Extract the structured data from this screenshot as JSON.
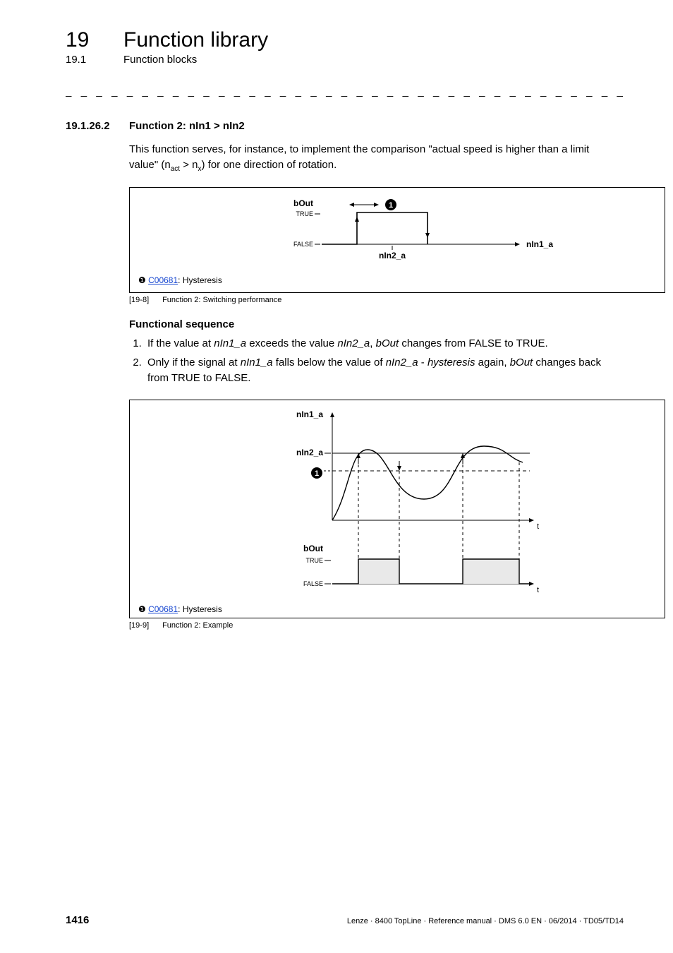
{
  "chapter": {
    "num": "19",
    "title": "Function library"
  },
  "section": {
    "num": "19.1",
    "title": "Function blocks"
  },
  "dash_rule": "_ _ _ _ _ _ _ _ _ _ _ _ _ _ _ _ _ _ _ _ _ _ _ _ _ _ _ _ _ _ _ _ _ _ _ _ _ _ _ _ _ _ _ _ _ _ _ _ _ _ _ _ _ _ _ _ _ _ _ _ _ _ _ _",
  "subsection": {
    "num": "19.1.26.2",
    "title": "Function 2: nIn1 > nIn2"
  },
  "intro": {
    "line1": "This function serves, for instance, to implement the comparison \"actual speed  is higher than a limit",
    "line2_pre": "value\" (n",
    "line2_sub1": "act",
    "line2_mid": " > n",
    "line2_sub2": "x",
    "line2_post": ") for one direction of rotation."
  },
  "fig8": {
    "labels": {
      "bOut": "bOut",
      "true": "TRUE",
      "false": "FALSE",
      "nIn2": "nIn2_a",
      "nIn1": "nIn1_a",
      "circ": "1"
    },
    "legend": {
      "bullet": "❶",
      "link": "C00681",
      "text": ": Hysteresis"
    },
    "caption_tag": "[19-8]",
    "caption_text": "Function 2: Switching performance"
  },
  "fs_head": "Functional sequence",
  "fs_items": [
    {
      "pre": "If the value at ",
      "i1": "nIn1_a",
      "mid1": " exceeds the value ",
      "i2": "nIn2_a",
      "mid2": ", ",
      "i3": "bOut",
      "post": " changes from FALSE to TRUE."
    },
    {
      "pre": "Only if the signal at ",
      "i1": "nIn1_a",
      "mid1": " falls below the value of ",
      "i2": "nIn2_a",
      "mid2": " - ",
      "i3": "hysteresis",
      "mid3": " again, ",
      "i4": "bOut",
      "post": " changes back from TRUE to FALSE."
    }
  ],
  "fig9": {
    "labels": {
      "nIn1": "nIn1_a",
      "nIn2": "nIn2_a",
      "circ": "1",
      "bOut": "bOut",
      "true": "TRUE",
      "false": "FALSE",
      "t": "t"
    },
    "legend": {
      "bullet": "❶",
      "link": "C00681",
      "text": ": Hysteresis"
    },
    "caption_tag": "[19-9]",
    "caption_text": "Function 2: Example"
  },
  "footer": {
    "page": "1416",
    "text": "Lenze · 8400 TopLine · Reference manual · DMS 6.0 EN · 06/2014 · TD05/TD14"
  }
}
